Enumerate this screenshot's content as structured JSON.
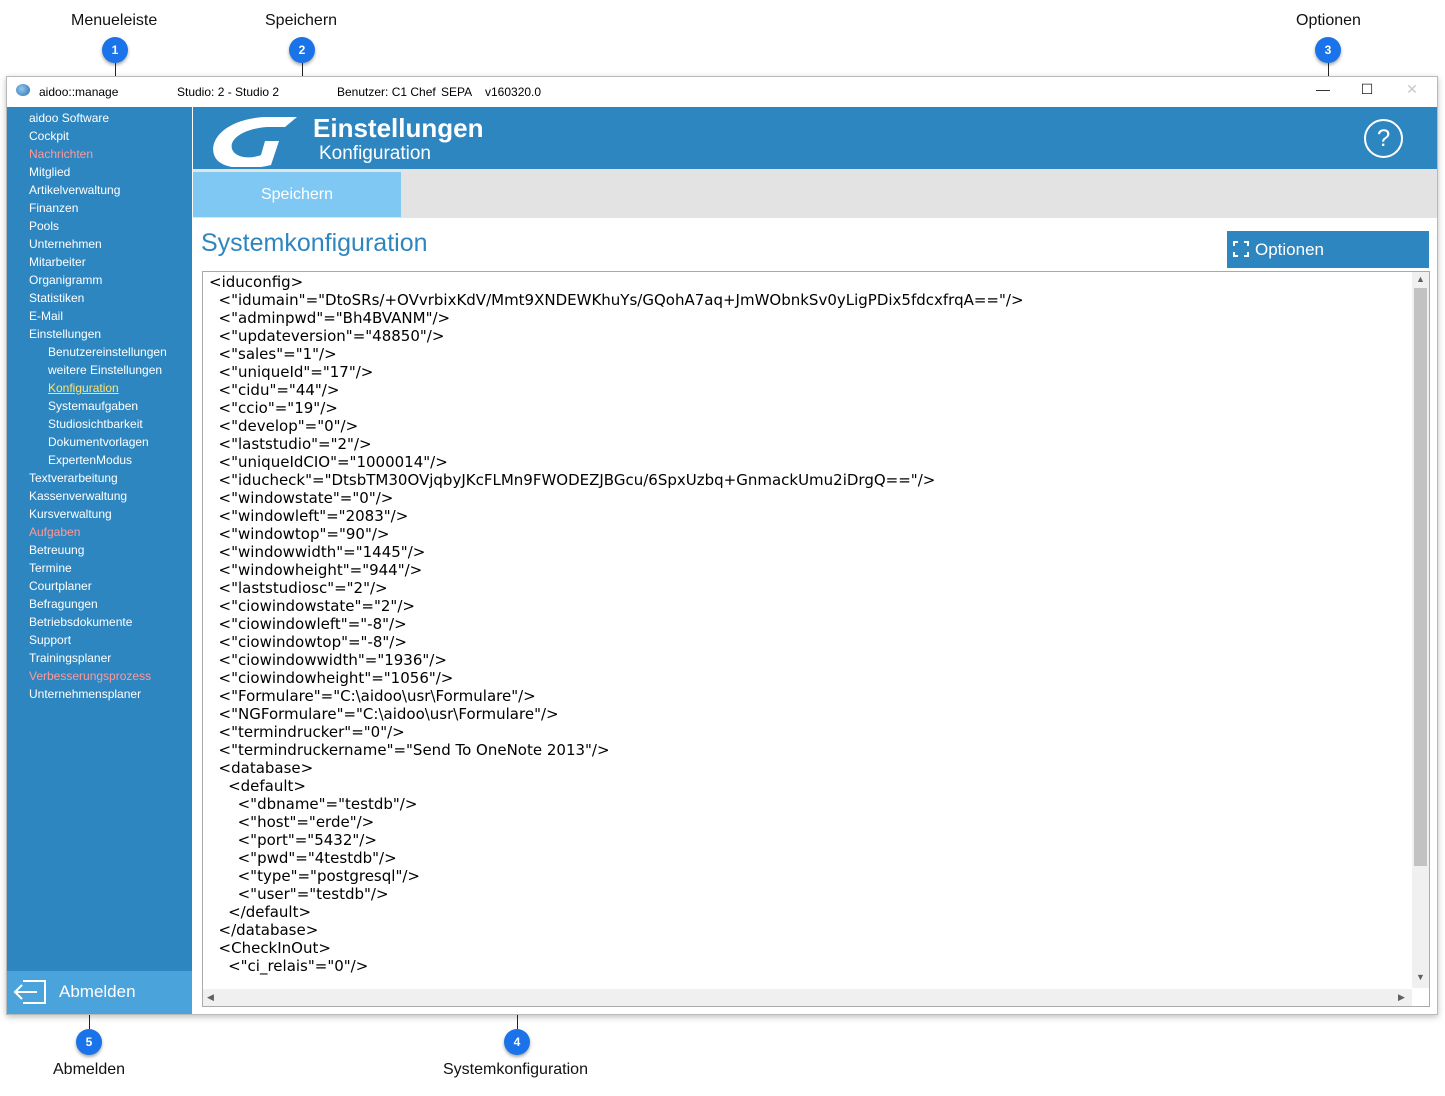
{
  "callouts": [
    {
      "number": "1",
      "label": "Menueleiste"
    },
    {
      "number": "2",
      "label": "Speichern"
    },
    {
      "number": "3",
      "label": "Optionen"
    },
    {
      "number": "4",
      "label": "Systemkonfiguration"
    },
    {
      "number": "5",
      "label": "Abmelden"
    }
  ],
  "titlebar": {
    "app_name": "aidoo::manage",
    "studio": "Studio: 2 - Studio 2",
    "user": "Benutzer: C1 Chef",
    "sepa": "SEPA",
    "version": "v160320.0",
    "minimize": "—",
    "maximize": "☐",
    "close": "✕"
  },
  "sidebar": {
    "items": [
      {
        "label": "aidoo Software",
        "state": "normal"
      },
      {
        "label": "Cockpit",
        "state": "normal"
      },
      {
        "label": "Nachrichten",
        "state": "highlight"
      },
      {
        "label": "Mitglied",
        "state": "normal"
      },
      {
        "label": "Artikelverwaltung",
        "state": "normal"
      },
      {
        "label": "Finanzen",
        "state": "normal"
      },
      {
        "label": "Pools",
        "state": "normal"
      },
      {
        "label": "Unternehmen",
        "state": "normal"
      },
      {
        "label": "Mitarbeiter",
        "state": "normal"
      },
      {
        "label": "Organigramm",
        "state": "normal"
      },
      {
        "label": "Statistiken",
        "state": "normal"
      },
      {
        "label": "E-Mail",
        "state": "normal"
      },
      {
        "label": "Einstellungen",
        "state": "normal"
      },
      {
        "label": "Benutzereinstellungen",
        "state": "normal",
        "sub": true
      },
      {
        "label": "weitere Einstellungen",
        "state": "normal",
        "sub": true
      },
      {
        "label": "Konfiguration",
        "state": "active",
        "sub": true
      },
      {
        "label": "Systemaufgaben",
        "state": "normal",
        "sub": true
      },
      {
        "label": "Studiosichtbarkeit",
        "state": "normal",
        "sub": true
      },
      {
        "label": "Dokumentvorlagen",
        "state": "normal",
        "sub": true
      },
      {
        "label": "ExpertenModus",
        "state": "normal",
        "sub": true
      },
      {
        "label": "Textverarbeitung",
        "state": "normal"
      },
      {
        "label": "Kassenverwaltung",
        "state": "normal"
      },
      {
        "label": "Kursverwaltung",
        "state": "normal"
      },
      {
        "label": "Aufgaben",
        "state": "highlight"
      },
      {
        "label": "Betreuung",
        "state": "normal"
      },
      {
        "label": "Termine",
        "state": "normal"
      },
      {
        "label": "Courtplaner",
        "state": "normal"
      },
      {
        "label": "Befragungen",
        "state": "normal"
      },
      {
        "label": "Betriebsdokumente",
        "state": "normal"
      },
      {
        "label": "Support",
        "state": "normal"
      },
      {
        "label": "Trainingsplaner",
        "state": "normal"
      },
      {
        "label": "Verbesserungsprozess",
        "state": "highlight"
      },
      {
        "label": "Unternehmensplaner",
        "state": "normal"
      }
    ],
    "logout_label": "Abmelden"
  },
  "header": {
    "title": "Einstellungen",
    "subtitle": "Konfiguration",
    "help": "?"
  },
  "toolbar": {
    "save_label": "Speichern"
  },
  "main": {
    "section_title": "Systemkonfiguration",
    "options_label": "Optionen",
    "config_lines": [
      "<iduconfig>",
      "  <\"idumain\"=\"DtoSRs/+OVvrbixKdV/Mmt9XNDEWKhuYs/GQohA7aq+JmWObnkSv0yLigPDix5fdcxfrqA==\"/>",
      "  <\"adminpwd\"=\"Bh4BVANM\"/>",
      "  <\"updateversion\"=\"48850\"/>",
      "  <\"sales\"=\"1\"/>",
      "  <\"uniqueId\"=\"17\"/>",
      "  <\"cidu\"=\"44\"/>",
      "  <\"ccio\"=\"19\"/>",
      "  <\"develop\"=\"0\"/>",
      "  <\"laststudio\"=\"2\"/>",
      "  <\"uniqueIdCIO\"=\"1000014\"/>",
      "  <\"iducheck\"=\"DtsbTM30OVjqbyJKcFLMn9FWODEZJBGcu/6SpxUzbq+GnmackUmu2iDrgQ==\"/>",
      "  <\"windowstate\"=\"0\"/>",
      "  <\"windowleft\"=\"2083\"/>",
      "  <\"windowtop\"=\"90\"/>",
      "  <\"windowwidth\"=\"1445\"/>",
      "  <\"windowheight\"=\"944\"/>",
      "  <\"laststudiosc\"=\"2\"/>",
      "  <\"ciowindowstate\"=\"2\"/>",
      "  <\"ciowindowleft\"=\"-8\"/>",
      "  <\"ciowindowtop\"=\"-8\"/>",
      "  <\"ciowindowwidth\"=\"1936\"/>",
      "  <\"ciowindowheight\"=\"1056\"/>",
      "  <\"Formulare\"=\"C:\\aidoo\\usr\\Formulare\"/>",
      "  <\"NGFormulare\"=\"C:\\aidoo\\usr\\Formulare\"/>",
      "  <\"termindrucker\"=\"0\"/>",
      "  <\"termindruckername\"=\"Send To OneNote 2013\"/>",
      "  <database>",
      "    <default>",
      "      <\"dbname\"=\"testdb\"/>",
      "      <\"host\"=\"erde\"/>",
      "      <\"port\"=\"5432\"/>",
      "      <\"pwd\"=\"4testdb\"/>",
      "      <\"type\"=\"postgresql\"/>",
      "      <\"user\"=\"testdb\"/>",
      "    </default>",
      "  </database>",
      "  <CheckInOut>",
      "    <\"ci_relais\"=\"0\"/>"
    ]
  },
  "scroll_arrows": {
    "up": "▲",
    "down": "▼",
    "left": "◀",
    "right": "▶"
  },
  "colors": {
    "brand_blue": "#2e86c1",
    "save_blue": "#7fc8f3",
    "highlight_red": "#ff9999",
    "active_yellow": "#ffe36e",
    "callout_blue": "#1a73e8"
  }
}
